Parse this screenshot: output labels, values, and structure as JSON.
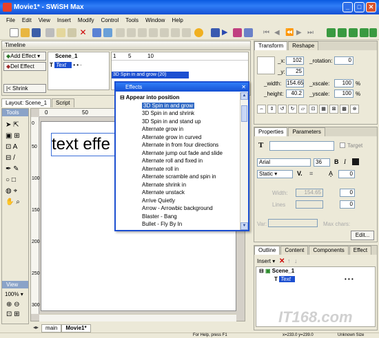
{
  "window": {
    "title": "Movie1* - SWiSH Max"
  },
  "menu": [
    "File",
    "Edit",
    "View",
    "Insert",
    "Modify",
    "Control",
    "Tools",
    "Window",
    "Help"
  ],
  "timeline": {
    "title": "Timeline",
    "add_effect": "Add Effect",
    "del_effect": "Del Effect",
    "shrink": "Shrink",
    "scene": "Scene_1",
    "text_item": "Text",
    "effect_bar": "3D Spin in and grow (20)",
    "ruler": [
      "1",
      "5",
      "10"
    ]
  },
  "layout": {
    "tab_layout": "Layout: Scene_1",
    "tab_script": "Script",
    "ruler": [
      "0",
      "50",
      "100"
    ],
    "ruler_v": [
      "0",
      "50",
      "100",
      "150",
      "200",
      "250",
      "300"
    ],
    "canvas_text": "text effe"
  },
  "tools": {
    "title": "Tools",
    "view_title": "View",
    "zoom": "100%"
  },
  "effects_popup": {
    "title": "Effects",
    "category": "Appear into position",
    "selected": "3D Spin in and grow",
    "items": [
      "3D Spin in and grow",
      "3D Spin in and shrink",
      "3D Spin in and stand up",
      "Alternate grow in",
      "Alternate grow in curved",
      "Alternate in from four directions",
      "Alternate jump out fade and slide",
      "Alternate roll and fixed in",
      "Alternate roll in",
      "Alternate scramble and spin in",
      "Alternate shrink in",
      "Alternate unstack",
      "Arrive Quietly",
      "Arrow - Arrowbic background",
      "Blaster - Bang",
      "Bullet - Fly By In"
    ]
  },
  "transform": {
    "tab_transform": "Transform",
    "tab_reshape": "Reshape",
    "x_label": "_x:",
    "x": "102",
    "y_label": "_y:",
    "y": "25",
    "width_label": "_width:",
    "width": "154.65",
    "height_label": "_height:",
    "height": "40.2",
    "rotation_label": "_rotation:",
    "rotation": "0",
    "xscale_label": "_xscale:",
    "xscale": "100",
    "xscale_unit": "%",
    "yscale_label": "_yscale:",
    "yscale": "100",
    "yscale_unit": "%"
  },
  "properties": {
    "tab_properties": "Properties",
    "tab_parameters": "Parameters",
    "target_label": "Target",
    "font": "Arial",
    "size": "36",
    "text_type": "Static",
    "width_label": "Width:",
    "width": "154.65",
    "lines_label": "Lines",
    "spacing1": "0",
    "spacing2": "0",
    "av_value": "0",
    "var_label": "Var:",
    "maxchars_label": "Max chars:",
    "edit": "Edit..."
  },
  "outline": {
    "tab_outline": "Outline",
    "tab_content": "Content",
    "tab_components": "Components",
    "tab_effect": "Effect",
    "insert": "Insert",
    "scene": "Scene_1",
    "text_item": "Text"
  },
  "bottom_tabs": {
    "main": "main",
    "movie": "Movie1*"
  },
  "status": {
    "help": "For Help, press F1",
    "coords": "x=233.0 y=239.0",
    "size": "Unknown Size"
  },
  "watermark": "IT168.com"
}
